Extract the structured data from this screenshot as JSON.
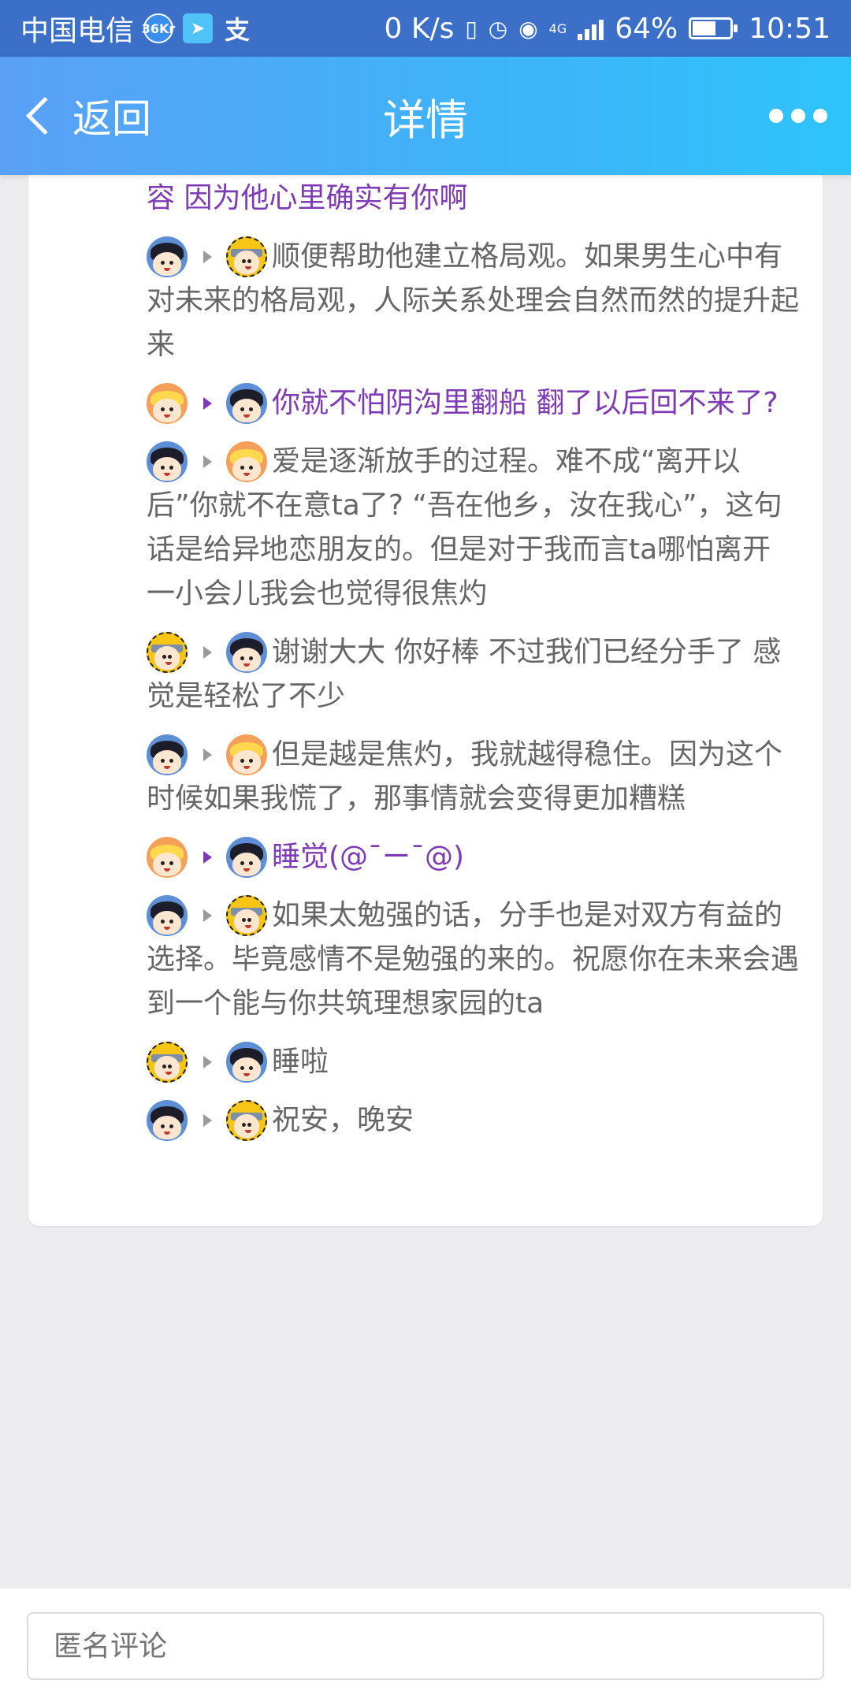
{
  "status_bar": {
    "carrier": "中国电信",
    "icon_kr": "36Kr",
    "icon_pay": "支",
    "network_speed": "0 K/s",
    "network_type": "4G",
    "battery": "64%",
    "battery_level": 0.64,
    "time": "10:51"
  },
  "header": {
    "back_label": "返回",
    "title": "详情"
  },
  "comments": [
    {
      "from": "orange",
      "to": "dark",
      "color": "purple",
      "text": "男生留功夫提正常的 是出于在乎 但是好像ta做的有点过了 即使这样也最好能给他更多的包容 因为他心里确实有你啊"
    },
    {
      "from": "dark",
      "to": "ninja",
      "color": "gray",
      "text": "顺便帮助他建立格局观。如果男生心中有对未来的格局观，人际关系处理会自然而然的提升起来"
    },
    {
      "from": "orange",
      "to": "dark",
      "color": "purple",
      "text": "你就不怕阴沟里翻船 翻了以后回不来了?"
    },
    {
      "from": "dark",
      "to": "orange",
      "color": "gray",
      "text": "爱是逐渐放手的过程。难不成“离开以后”你就不在意ta了? “吾在他乡，汝在我心”，这句话是给异地恋朋友的。但是对于我而言ta哪怕离开一小会儿我会也觉得很焦灼"
    },
    {
      "from": "ninja",
      "to": "dark",
      "color": "gray",
      "text": "谢谢大大 你好棒 不过我们已经分手了 感觉是轻松了不少"
    },
    {
      "from": "dark",
      "to": "orange",
      "color": "gray",
      "text": "但是越是焦灼，我就越得稳住。因为这个时候如果我慌了，那事情就会变得更加糟糕"
    },
    {
      "from": "orange",
      "to": "dark",
      "color": "purple",
      "text": "睡觉(@¯ー¯@)"
    },
    {
      "from": "dark",
      "to": "ninja",
      "color": "gray",
      "text": "如果太勉强的话，分手也是对双方有益的选择。毕竟感情不是勉强的来的。祝愿你在未来会遇到一个能与你共筑理想家园的ta"
    },
    {
      "from": "ninja",
      "to": "dark",
      "color": "gray",
      "text": "睡啦"
    },
    {
      "from": "dark",
      "to": "ninja",
      "color": "gray",
      "text": "祝安，晚安"
    }
  ],
  "comment_input": {
    "placeholder": "匿名评论"
  }
}
